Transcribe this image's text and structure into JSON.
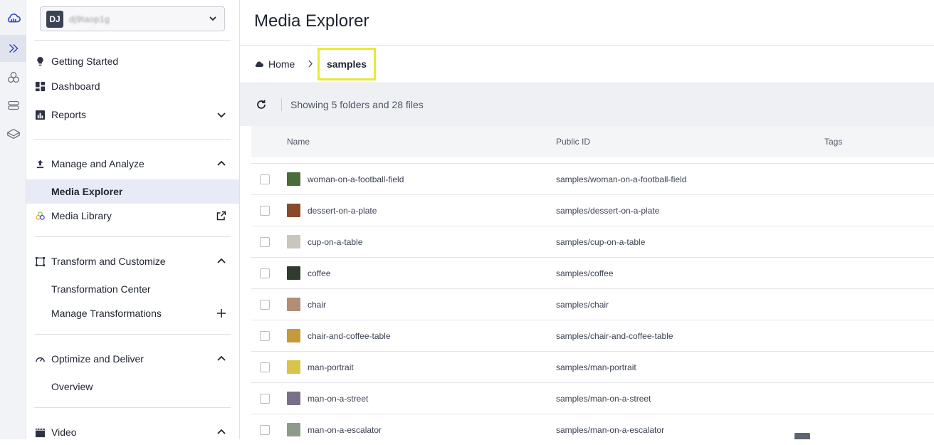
{
  "account": {
    "badge": "DJ",
    "name": "dj9taop1g"
  },
  "rail": {
    "items": [
      {
        "icon": "cloud-logo-icon"
      },
      {
        "icon": "double-chevron-icon"
      },
      {
        "icon": "assets-icon"
      },
      {
        "icon": "pipeline-icon"
      },
      {
        "icon": "box-icon"
      }
    ]
  },
  "sidebar": {
    "getting_started": "Getting Started",
    "dashboard": "Dashboard",
    "reports": "Reports",
    "manage_analyze": "Manage and Analyze",
    "media_explorer": "Media Explorer",
    "media_library": "Media Library",
    "transform_customize": "Transform and Customize",
    "transformation_center": "Transformation Center",
    "manage_transformations": "Manage Transformations",
    "optimize_deliver": "Optimize and Deliver",
    "overview": "Overview",
    "video": "Video"
  },
  "main": {
    "title": "Media Explorer",
    "breadcrumb": {
      "home": "Home",
      "current": "samples"
    },
    "summary": "Showing 5 folders and 28 files",
    "columns": {
      "name": "Name",
      "public_id": "Public ID",
      "tags": "Tags"
    },
    "rows": [
      {
        "name": "woman-on-a-football-field",
        "public_id": "samples/woman-on-a-football-field",
        "thumb": "#4a6b3a"
      },
      {
        "name": "dessert-on-a-plate",
        "public_id": "samples/dessert-on-a-plate",
        "thumb": "#8a4a2a"
      },
      {
        "name": "cup-on-a-table",
        "public_id": "samples/cup-on-a-table",
        "thumb": "#c9c6bd"
      },
      {
        "name": "coffee",
        "public_id": "samples/coffee",
        "thumb": "#2f3b2c"
      },
      {
        "name": "chair",
        "public_id": "samples/chair",
        "thumb": "#b08f76"
      },
      {
        "name": "chair-and-coffee-table",
        "public_id": "samples/chair-and-coffee-table",
        "thumb": "#c69a3a"
      },
      {
        "name": "man-portrait",
        "public_id": "samples/man-portrait",
        "thumb": "#d8c44a"
      },
      {
        "name": "man-on-a-street",
        "public_id": "samples/man-on-a-street",
        "thumb": "#7a6f88"
      },
      {
        "name": "man-on-a-escalator",
        "public_id": "samples/man-on-a-escalator",
        "thumb": "#8f9b8a"
      }
    ]
  },
  "colors": {
    "highlight": "#e9e935",
    "selected_bg": "#e8ebf5",
    "rail_bg": "#f2f3f6",
    "brand": "#3448c5"
  }
}
